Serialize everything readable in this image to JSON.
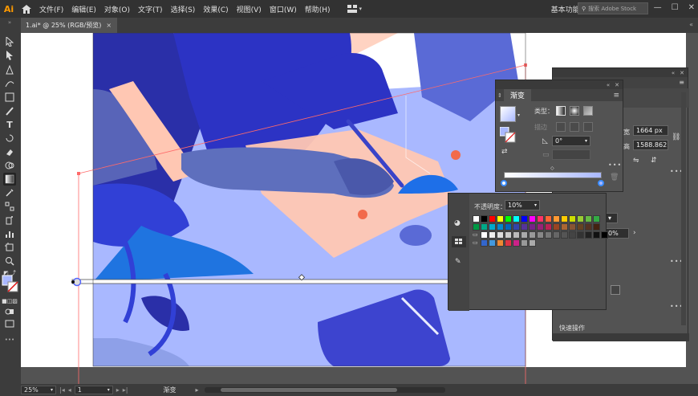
{
  "app": {
    "logo": "Ai"
  },
  "menu": [
    "文件(F)",
    "编辑(E)",
    "对象(O)",
    "文字(T)",
    "选择(S)",
    "效果(C)",
    "视图(V)",
    "窗口(W)",
    "帮助(H)"
  ],
  "workspace": "基本功能",
  "search": {
    "placeholder": "搜索 Adobe Stock"
  },
  "document_tab": {
    "title": "1.ai* @ 25% (RGB/预览)",
    "close": "×"
  },
  "statusbar": {
    "zoom": "25%",
    "page": "1",
    "tool_name": "渐变"
  },
  "gradient_panel": {
    "title": "渐变",
    "type_label": "类型：",
    "stroke_label": "描边",
    "angle": "0°"
  },
  "swatch_popup": {
    "opacity_label": "不透明度：",
    "opacity_value": "10%"
  },
  "transform_panel": {
    "width_label": "宽",
    "height_label": "高",
    "width_value": "1664 px",
    "height_value": "1588.862",
    "percent": "0%",
    "quick_actions": "快速操作"
  },
  "colors": {
    "accent": "#31a8ff",
    "ai_orange": "#ff9a00",
    "art_dark_blue": "#2c33c4",
    "art_skin": "#ffc7b3",
    "art_light": "#a9b8ff"
  },
  "swatches": {
    "row1": [
      "#ffffff",
      "#000000",
      "#ff0000",
      "#ffff00",
      "#00ff00",
      "#00ffff",
      "#0000ff",
      "#ff00ff",
      "#ff3366",
      "#ff6633",
      "#ff9933",
      "#ffcc00",
      "#ccdd00",
      "#99cc33",
      "#66bb44",
      "#33aa44"
    ],
    "row2": [
      "#009944",
      "#00aa88",
      "#00aacc",
      "#0088cc",
      "#0066bb",
      "#3344aa",
      "#553399",
      "#772288",
      "#992277",
      "#bb2255",
      "#994422",
      "#aa6633",
      "#885533",
      "#664422",
      "#553322",
      "#442211"
    ],
    "row3": [
      "#ffffff",
      "#eeeeee",
      "#dddddd",
      "#cccccc",
      "#bbbbbb",
      "#aaaaaa",
      "#999999",
      "#888888",
      "#777777",
      "#666666",
      "#555555",
      "#444444",
      "#333333",
      "#222222",
      "#111111",
      "#000000"
    ],
    "row4": [
      "#3366cc",
      "#4499dd",
      "#ee8833",
      "#dd3344",
      "#cc2288",
      "#999999",
      "#aaaaaa"
    ]
  }
}
